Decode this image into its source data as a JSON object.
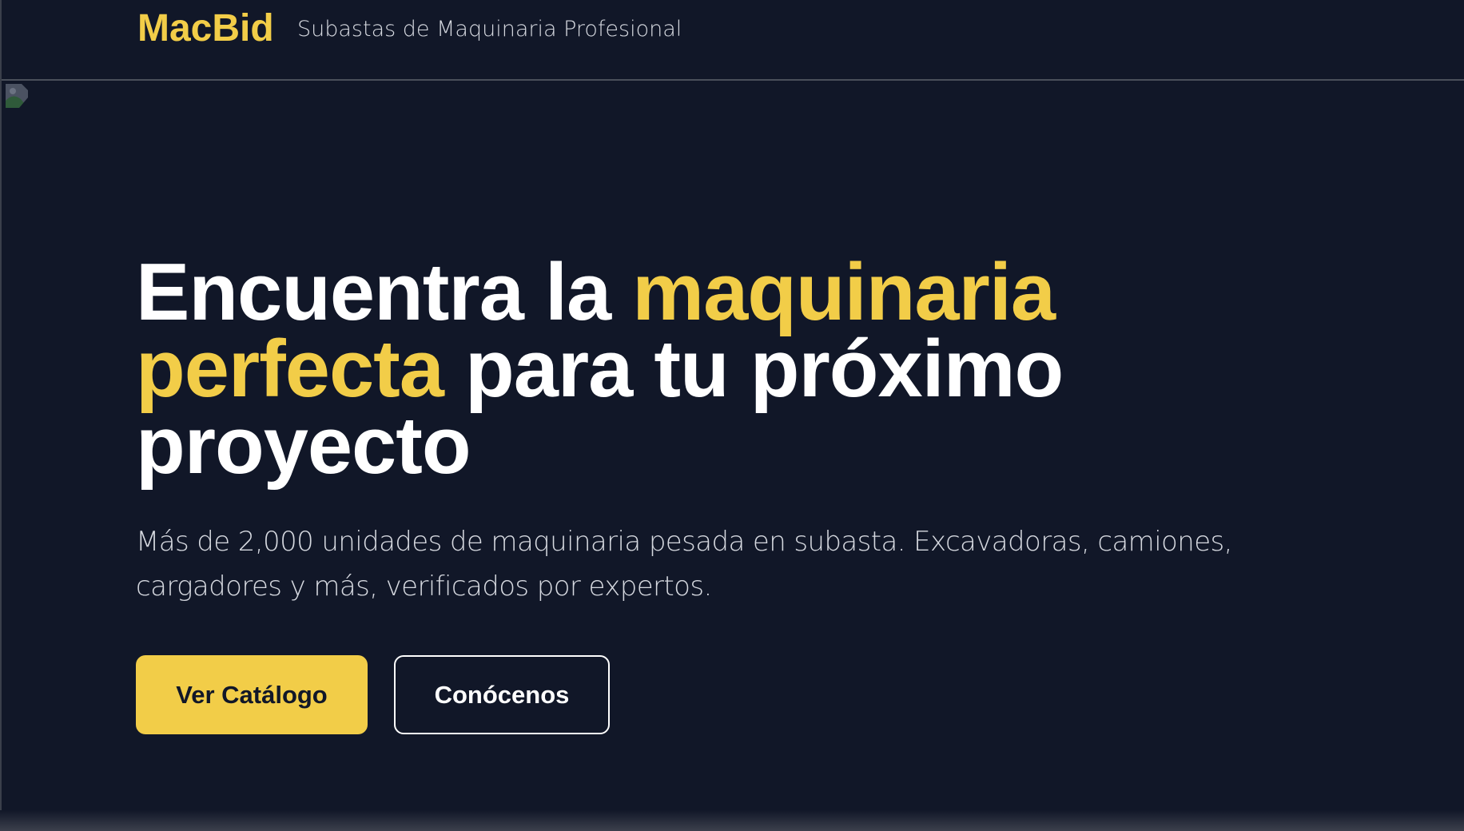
{
  "header": {
    "logo": "MacBid",
    "tagline": "Subastas de Maquinaria Profesional"
  },
  "hero": {
    "headline": {
      "part1": "Encuentra la ",
      "highlight1": "maquinaria perfecta",
      "part2": " para tu próximo proyecto"
    },
    "description": "Más de 2,000 unidades de maquinaria pesada en subasta. Excavadoras, camiones, cargadores y más, verificados por expertos.",
    "primary_button": "Ver Catálogo",
    "secondary_button": "Conócenos"
  },
  "colors": {
    "background": "#111728",
    "accent": "#f2cd48"
  }
}
